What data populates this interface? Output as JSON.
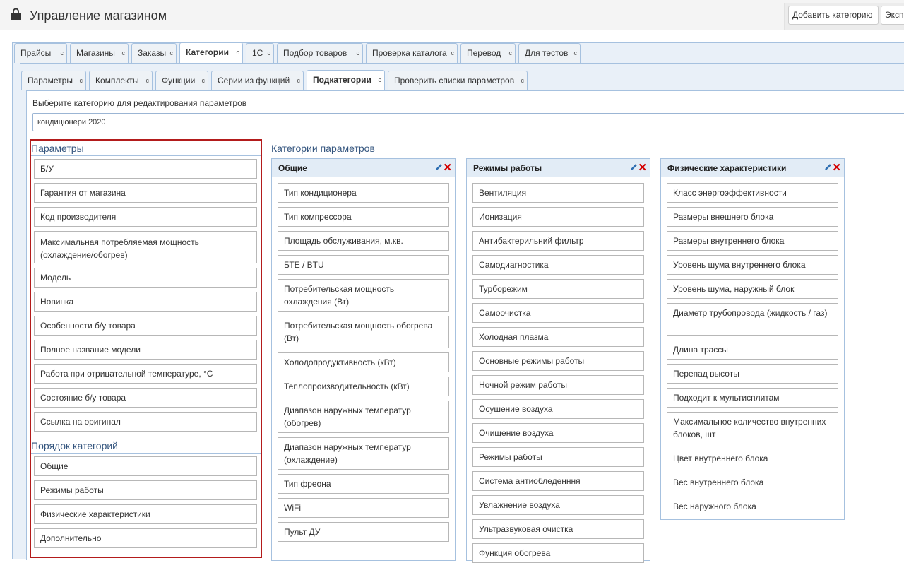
{
  "app": {
    "title": "Управление магазином",
    "icon": "shopping-bag-icon"
  },
  "toolbar": {
    "add_category": "Добавить категорию",
    "export": "Экспорт"
  },
  "main_tabs": [
    "Прайсы",
    "Магазины",
    "Заказы",
    "Категории",
    "1C",
    "Подбор товаров",
    "Проверка каталога",
    "Перевод",
    "Для тестов"
  ],
  "main_tabs_active": "Категории",
  "sub_tabs": [
    "Параметры",
    "Комплекты",
    "Функции",
    "Серии из функций",
    "Подкатегории",
    "Проверить списки параметров"
  ],
  "sub_tabs_active": "Подкатегории",
  "refresh_glyph": "c",
  "selector": {
    "label": "Выберите категорию для редактирования параметров",
    "value": "кондиціонери 2020"
  },
  "params": {
    "title": "Параметры",
    "items": [
      "Б/У",
      "Гарантия от магазина",
      "Код производителя",
      "Максимальная потребляемая мощность (охлаждение/обогрев)",
      "Модель",
      "Новинка",
      "Особенности б/у товара",
      "Полное название модели",
      "Работа при отрицательной температуре, °C",
      "Состояние б/у товара",
      "Ссылка на оригинал"
    ]
  },
  "order": {
    "title": "Порядок категорий",
    "items": [
      "Общие",
      "Режимы работы",
      "Физические характеристики",
      "Дополнительно"
    ]
  },
  "categories": {
    "title": "Категории параметров",
    "columns": [
      {
        "name": "Общие",
        "items": [
          "Тип кондиционера",
          "Тип компрессора",
          "Площадь обслуживания, м.кв.",
          "БТЕ / BTU",
          "Потребительская мощность охлаждения (Вт)",
          "Потребительская мощность обогрева (Вт)",
          "Холодопродуктивность (кВт)",
          "Теплопроизводительность (кВт)",
          "Диапазон наружных температур (обогрев)",
          "Диапазон наружных температур (охлаждение)",
          "Тип фреона",
          "WiFi",
          "Пульт ДУ"
        ]
      },
      {
        "name": "Режимы работы",
        "items": [
          "Вентиляция",
          "Ионизация",
          "Антибактерильний фильтр",
          "Самодиагностика",
          "Турборежим",
          "Самоочистка",
          "Холодная плазма",
          "Основные режимы работы",
          "Ночной режим работы",
          "Осушение воздуха",
          "Очищение воздуха",
          "Режимы работы",
          "Система антиобледенння",
          "Увлажнение воздуха",
          "Ультразвуковая очистка",
          "Функция обогрева"
        ]
      },
      {
        "name": "Физические характеристики",
        "items": [
          "Класс энергоэффективности",
          "Размеры внешнего блока",
          "Размеры внутреннего блока",
          "Уровень шума внутреннего блока",
          "Уровень шума, наружный блок",
          "Диаметр трубопровода (жидкость / газ)",
          "Длина трассы",
          "Перепад высоты",
          "Подходит к мультисплитам",
          "Максимальное количество внутренних блоков, шт",
          "Цвет внутреннего блока",
          "Вес внутреннего блока",
          "Вес наружного блока"
        ]
      }
    ]
  },
  "colors": {
    "tab_border": "#a6c1df",
    "header_bg": "#e2ecf6",
    "highlight_border": "#b31b1b",
    "delete": "#d40000",
    "title_blue": "#35567f"
  }
}
